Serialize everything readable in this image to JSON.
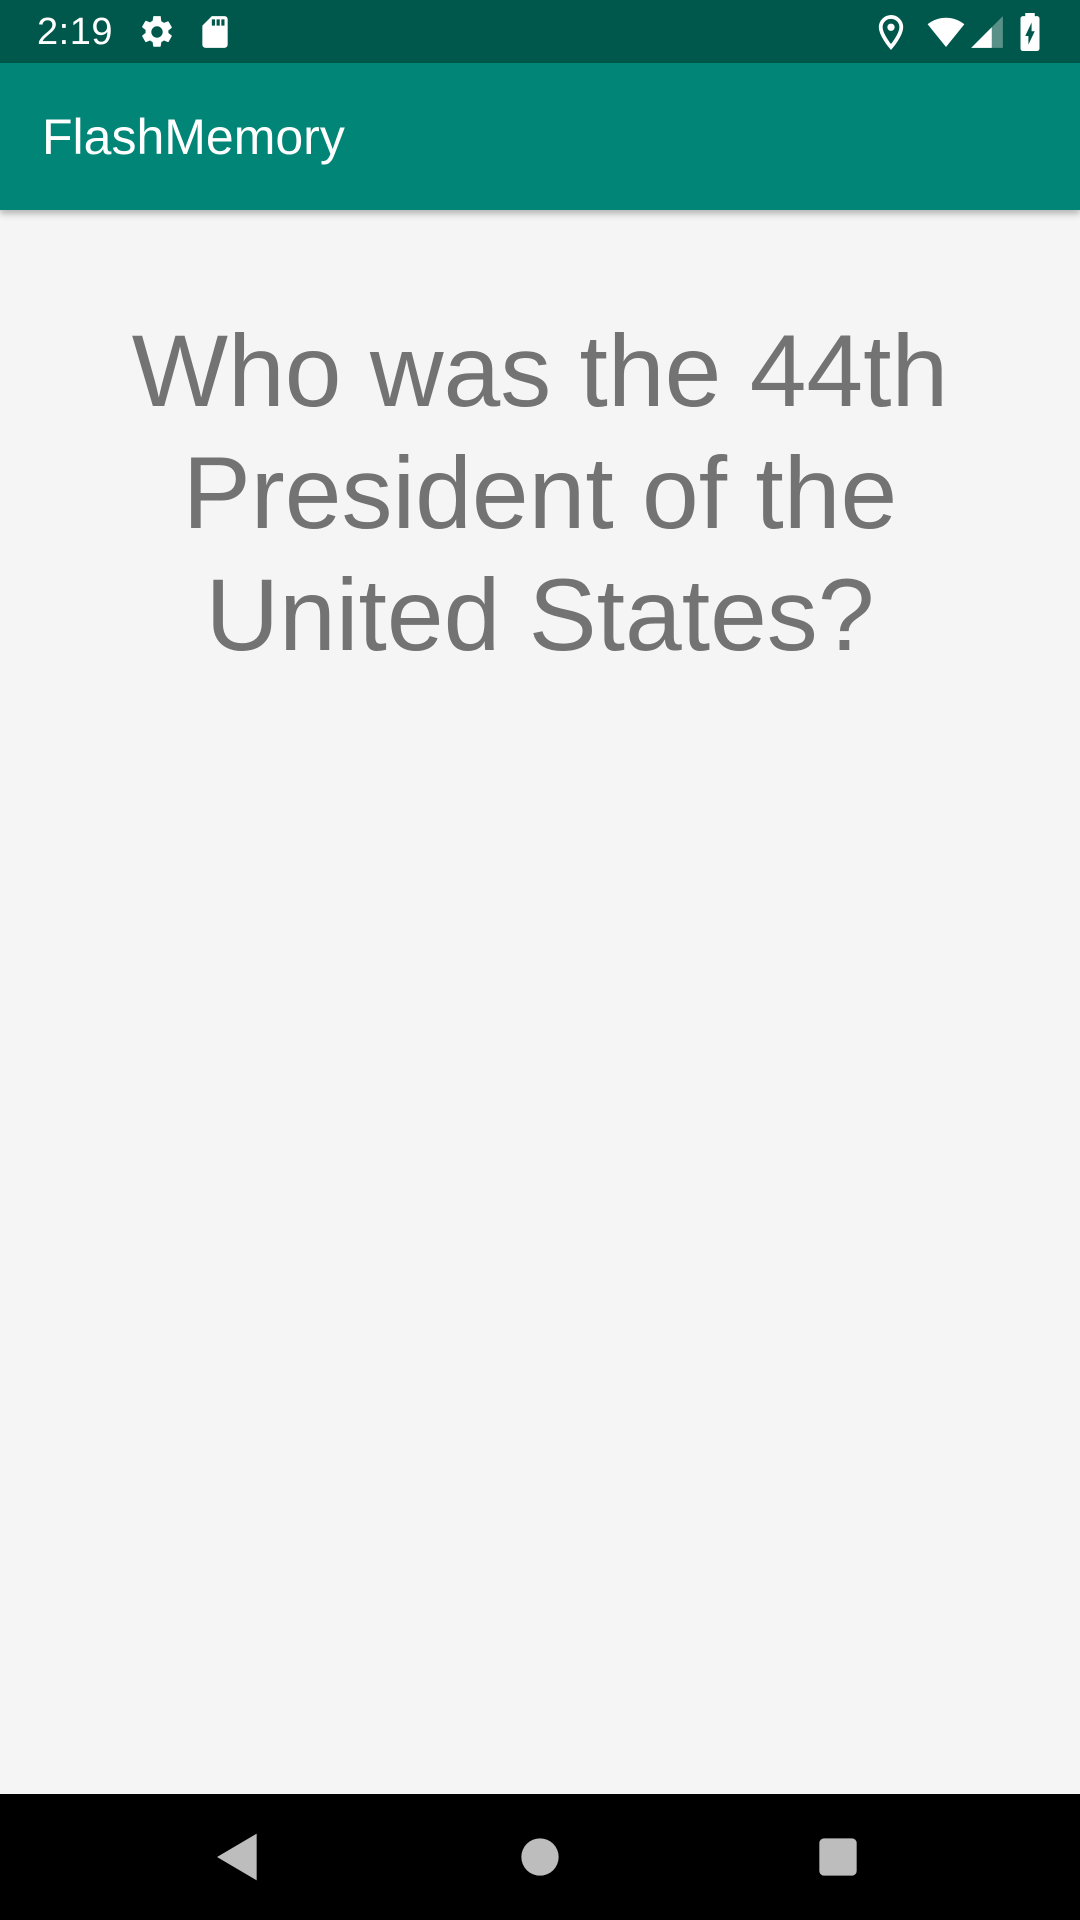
{
  "status_bar": {
    "time": "2:19",
    "icons": [
      "gear-icon",
      "sd-card-icon",
      "location-icon",
      "wifi-icon",
      "signal-icon",
      "battery-charging-icon"
    ]
  },
  "app_bar": {
    "title": "FlashMemory",
    "color": "#008577",
    "status_color": "#00574b"
  },
  "card": {
    "question": "Who was the 44th\nPresident of the\nUnited States?"
  },
  "nav_bar": {
    "buttons": [
      "back-icon",
      "home-icon",
      "recents-icon"
    ]
  }
}
